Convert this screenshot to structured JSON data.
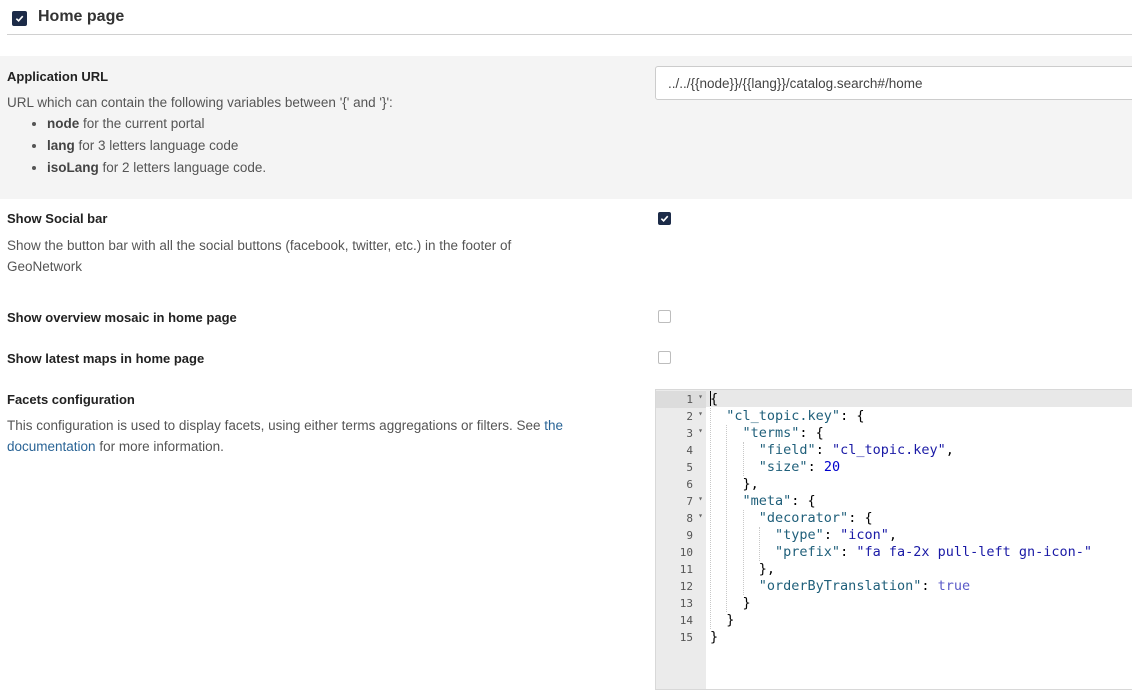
{
  "section": {
    "title": "Home page",
    "enabled": true
  },
  "app_url": {
    "label": "Application URL",
    "description": "URL which can contain the following variables between '{' and '}':",
    "variables": [
      {
        "name": "node",
        "text": " for the current portal"
      },
      {
        "name": "lang",
        "text": " for 3 letters language code"
      },
      {
        "name": "isoLang",
        "text": " for 2 letters language code."
      }
    ],
    "value": "../../{{node}}/{{lang}}/catalog.search#/home"
  },
  "social_bar": {
    "label": "Show Social bar",
    "description": "Show the button bar with all the social buttons (facebook, twitter, etc.) in the footer of GeoNetwork",
    "checked": true
  },
  "overview_mosaic": {
    "label": "Show overview mosaic in home page",
    "checked": false
  },
  "latest_maps": {
    "label": "Show latest maps in home page",
    "checked": false
  },
  "facets": {
    "label": "Facets configuration",
    "description_before": "This configuration is used to display facets, using either terms aggregations or filters. See ",
    "link_text": "the documentation",
    "description_after": " for more information.",
    "editor": {
      "line_numbers": [
        "1",
        "2",
        "3",
        "4",
        "5",
        "6",
        "7",
        "8",
        "9",
        "10",
        "11",
        "12",
        "13",
        "14",
        "15"
      ],
      "foldable_lines": [
        1,
        2,
        3,
        7,
        8
      ],
      "lines": [
        "{",
        "  \"cl_topic.key\": {",
        "    \"terms\": {",
        "      \"field\": \"cl_topic.key\",",
        "      \"size\": 20",
        "    },",
        "    \"meta\": {",
        "      \"decorator\": {",
        "        \"type\": \"icon\",",
        "        \"prefix\": \"fa fa-2x pull-left gn-icon-\"",
        "      },",
        "      \"orderByTranslation\": true",
        "    }",
        "  }",
        "}"
      ]
    }
  },
  "colors": {
    "checkbox_checked": "#1c2b48",
    "link": "#2a6496",
    "shaded_row": "#f4f4f4",
    "json_key": "#1f5f7a",
    "json_string": "#1a1aa6",
    "json_number": "#0000cd"
  }
}
